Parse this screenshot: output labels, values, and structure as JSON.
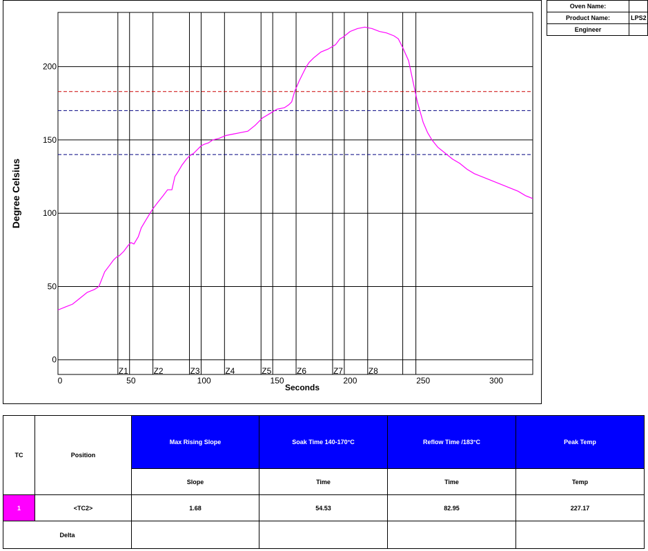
{
  "info": {
    "oven_label": "Oven Name:",
    "oven_value": "",
    "product_label": "Product Name:",
    "product_value": "LPS2",
    "engineer_label": "Engineer",
    "engineer_value": ""
  },
  "chart_data": {
    "type": "line",
    "title": "",
    "xlabel": "Seconds",
    "ylabel": "Degree Celsius",
    "xlim": [
      0,
      325
    ],
    "ylim": [
      -10,
      237
    ],
    "xticks": [
      0,
      50,
      100,
      150,
      200,
      250,
      300
    ],
    "yticks": [
      0,
      50,
      100,
      150,
      200
    ],
    "grid": true,
    "legend": "none",
    "series_color": "#ff00ff",
    "zones": [
      {
        "label": "Z1",
        "start": 41,
        "end": 49
      },
      {
        "label": "Z2",
        "start": 65,
        "end": 65
      },
      {
        "label": "Z3",
        "start": 90,
        "end": 98
      },
      {
        "label": "Z4",
        "start": 114,
        "end": 114
      },
      {
        "label": "Z5",
        "start": 139,
        "end": 147
      },
      {
        "label": "Z6",
        "start": 163,
        "end": 163
      },
      {
        "label": "Z7",
        "start": 188,
        "end": 196
      },
      {
        "label": "Z8",
        "start": 212,
        "end": 212
      },
      {
        "label": "",
        "start": 236,
        "end": 245
      }
    ],
    "reference_lines": [
      {
        "y": 183,
        "color": "#cc0000"
      },
      {
        "y": 170,
        "color": "#000080"
      },
      {
        "y": 140,
        "color": "#000080"
      }
    ],
    "series": [
      {
        "x": [
          0,
          5,
          10,
          15,
          20,
          25,
          28,
          30,
          32,
          35,
          38,
          40,
          42,
          45,
          48,
          50,
          52,
          55,
          57,
          60,
          63,
          65,
          68,
          72,
          75,
          78,
          80,
          82,
          85,
          88,
          90,
          93,
          95,
          98,
          100,
          103,
          106,
          110,
          115,
          120,
          125,
          130,
          135,
          140,
          145,
          150,
          155,
          158,
          160,
          162,
          165,
          168,
          170,
          172,
          175,
          180,
          185,
          190,
          193,
          195,
          200,
          205,
          210,
          215,
          220,
          225,
          230,
          233,
          236,
          240,
          243,
          246,
          250,
          253,
          256,
          260,
          265,
          270,
          275,
          280,
          285,
          290,
          295,
          300,
          305,
          310,
          315,
          320,
          325
        ],
        "y": [
          34,
          36,
          38,
          42,
          46,
          48,
          50,
          55,
          60,
          64,
          68,
          70,
          71,
          74,
          78,
          80,
          79,
          84,
          90,
          95,
          100,
          103,
          107,
          112,
          116,
          116,
          125,
          128,
          133,
          137,
          139,
          141,
          143,
          146,
          147,
          148,
          150,
          151,
          153,
          154,
          155,
          156,
          160,
          165,
          168,
          171,
          172,
          174,
          176,
          183,
          190,
          196,
          200,
          203,
          206,
          210,
          212,
          215,
          219,
          220,
          224,
          226,
          227,
          226,
          224,
          223,
          221,
          219,
          213,
          204,
          190,
          176,
          162,
          155,
          150,
          145,
          141,
          137,
          134,
          130,
          127,
          125,
          123,
          121,
          119,
          117,
          115,
          112,
          110
        ]
      }
    ]
  },
  "results": {
    "tc_header": "TC",
    "position_header": "Position",
    "columns": [
      "Max Rising Slope",
      "Soak Time 140-170°C",
      "Reflow Time /183°C",
      "Peak Temp"
    ],
    "units": [
      "Slope",
      "Time",
      "Time",
      "Temp"
    ],
    "row": {
      "tc": "1",
      "position": "<TC2>",
      "values": [
        "1.68",
        "54.53",
        "82.95",
        "227.17"
      ]
    },
    "delta_label": "Delta"
  }
}
